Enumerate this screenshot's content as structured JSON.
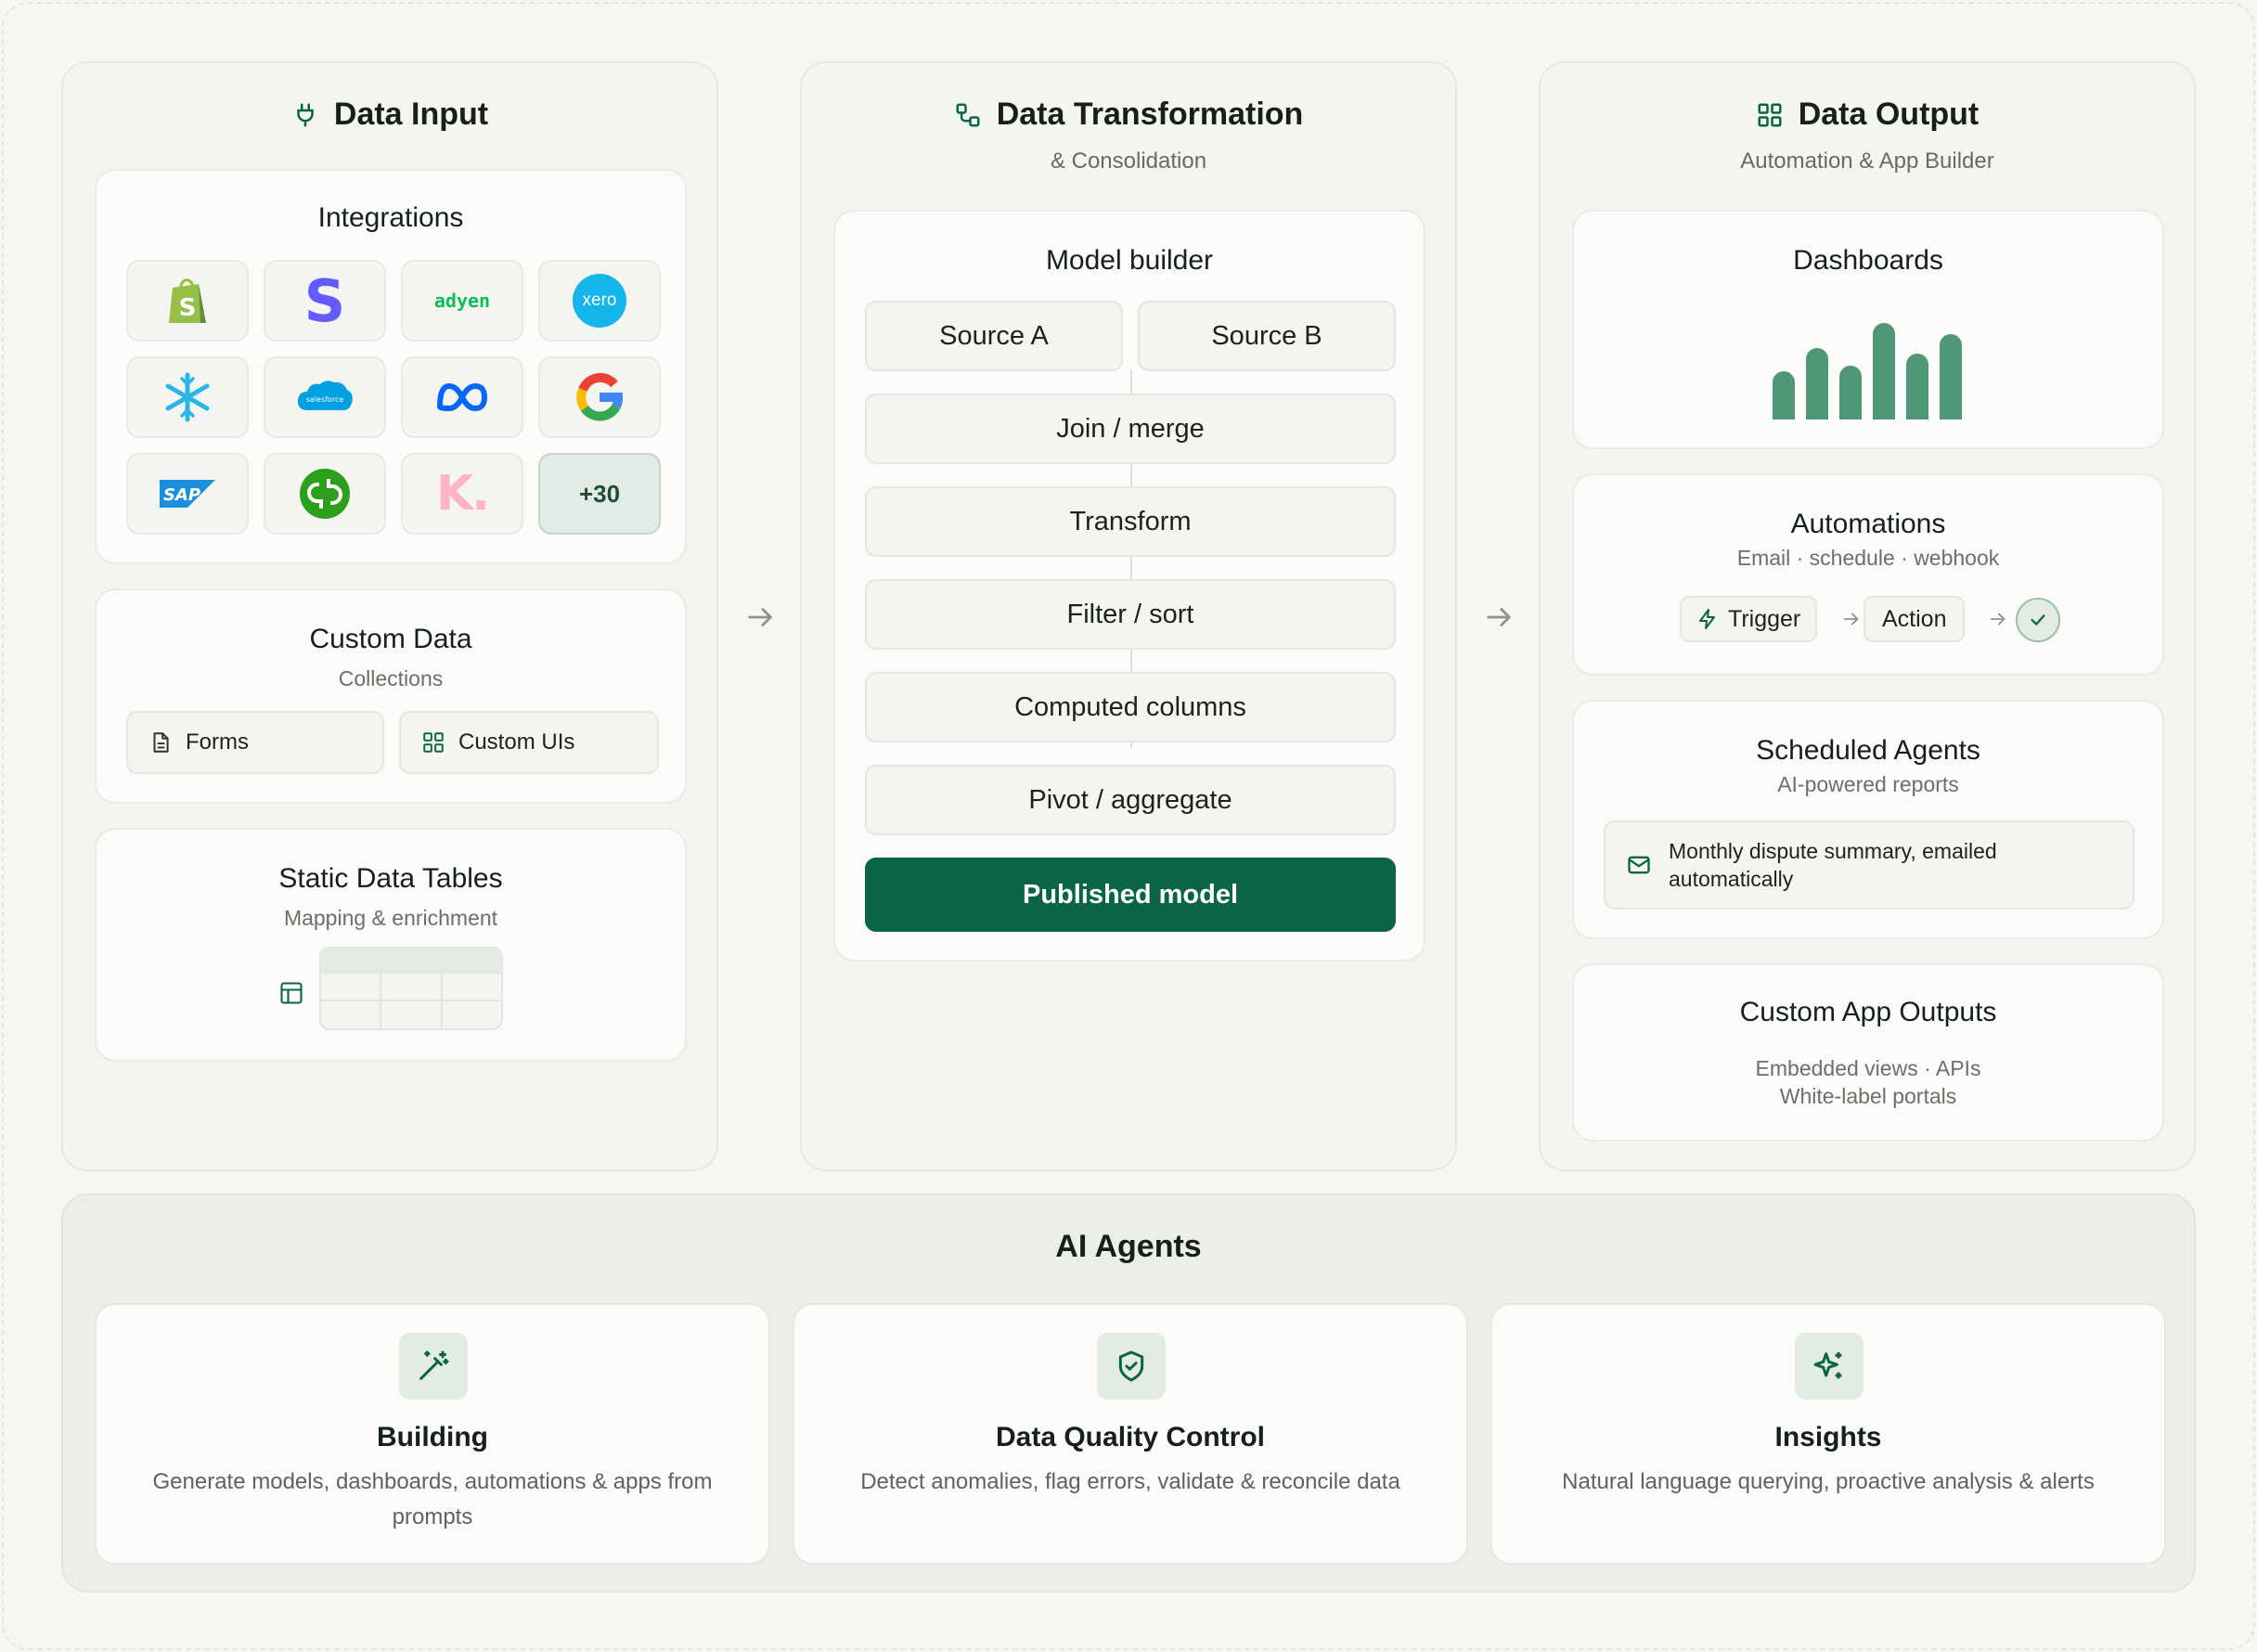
{
  "colors": {
    "accent": "#0a6446",
    "bar": "#4f9777",
    "page_bg": "#f7f7f2"
  },
  "input": {
    "title": "Data Input",
    "icon": "plug-icon",
    "integrations": {
      "title": "Integrations",
      "logos": [
        "shopify-logo",
        "stripe-logo",
        "adyen-logo",
        "xero-logo",
        "snowflake-logo",
        "salesforce-logo",
        "meta-logo",
        "google-logo",
        "sap-logo",
        "quickbooks-logo",
        "klarna-logo"
      ],
      "adyen_text": "adyen",
      "xero_text": "xero",
      "salesforce_text": "salesforce",
      "sap_text": "SAP",
      "klarna_text": "K.",
      "more_label": "+30"
    },
    "custom_data": {
      "title": "Custom Data",
      "subtitle": "Collections",
      "forms_label": "Forms",
      "custom_uis_label": "Custom UIs"
    },
    "static_tables": {
      "title": "Static Data Tables",
      "subtitle": "Mapping & enrichment"
    }
  },
  "transform": {
    "title": "Data Transformation",
    "subtitle": "& Consolidation",
    "model_builder": {
      "title": "Model builder",
      "source_a": "Source A",
      "source_b": "Source B",
      "steps": [
        "Join / merge",
        "Transform",
        "Filter / sort",
        "Computed columns",
        "Pivot / aggregate"
      ],
      "published": "Published model"
    }
  },
  "output": {
    "title": "Data Output",
    "subtitle": "Automation & App Builder",
    "dashboards": {
      "title": "Dashboards",
      "bar_levels": [
        0.5,
        0.74,
        0.56,
        1.0,
        0.68,
        0.88
      ]
    },
    "automations": {
      "title": "Automations",
      "subtitle": "Email · schedule · webhook",
      "trigger_label": "Trigger",
      "action_label": "Action"
    },
    "scheduled_agents": {
      "title": "Scheduled Agents",
      "subtitle": "AI-powered reports",
      "report_text": "Monthly dispute summary, emailed automatically"
    },
    "custom_app": {
      "title": "Custom App Outputs",
      "line1": "Embedded views · APIs",
      "line2": "White-label portals"
    }
  },
  "agents": {
    "title": "AI Agents",
    "items": [
      {
        "title": "Building",
        "desc": "Generate models, dashboards, automations & apps from prompts",
        "icon": "magic-wand-icon"
      },
      {
        "title": "Data Quality Control",
        "desc": "Detect anomalies, flag errors, validate & reconcile data",
        "icon": "shield-check-icon"
      },
      {
        "title": "Insights",
        "desc": "Natural language querying, proactive analysis & alerts",
        "icon": "sparkles-icon"
      }
    ]
  }
}
